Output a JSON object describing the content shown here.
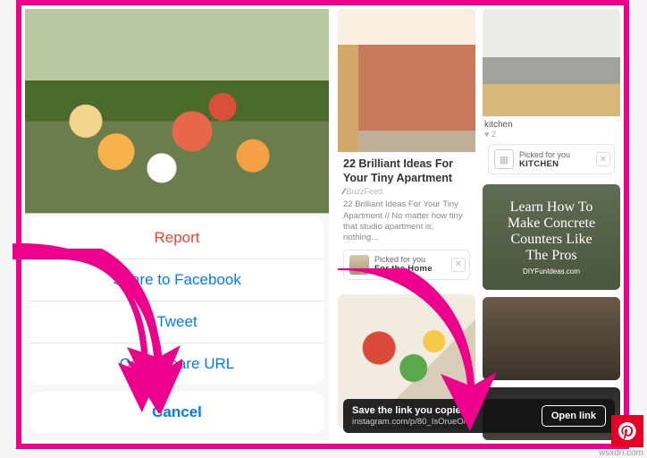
{
  "frame_color": "#ec008c",
  "left": {
    "sheet": {
      "report": "Report",
      "share_fb": "Share to Facebook",
      "tweet": "Tweet",
      "copy_url": "Copy Share URL",
      "cancel": "Cancel"
    }
  },
  "right": {
    "pin_apartment": {
      "title": "22 Brilliant Ideas For Your Tiny Apartment",
      "source": "BuzzFeed",
      "desc": "22 Brilliant Ideas For Your Tiny Apartment // No matter how tiny that studio apartment is, nothing...",
      "picked_label": "Picked for you",
      "picked_board": "For the Home"
    },
    "pin_kitchen": {
      "caption": "kitchen",
      "likes": "2",
      "picked_label": "Picked for you",
      "picked_board": "KITCHEN"
    },
    "pin_counters": {
      "line1": "Learn How To",
      "line2": "Make Concrete",
      "line3": "Counters Like",
      "line4": "The Pros",
      "credit": "DIYFunIdeas.com"
    },
    "toast": {
      "title": "Save the link you copied?",
      "url": "instagram.com/p/80_IsOrueO/",
      "button": "Open link"
    }
  },
  "watermark": "wsxdn.com"
}
